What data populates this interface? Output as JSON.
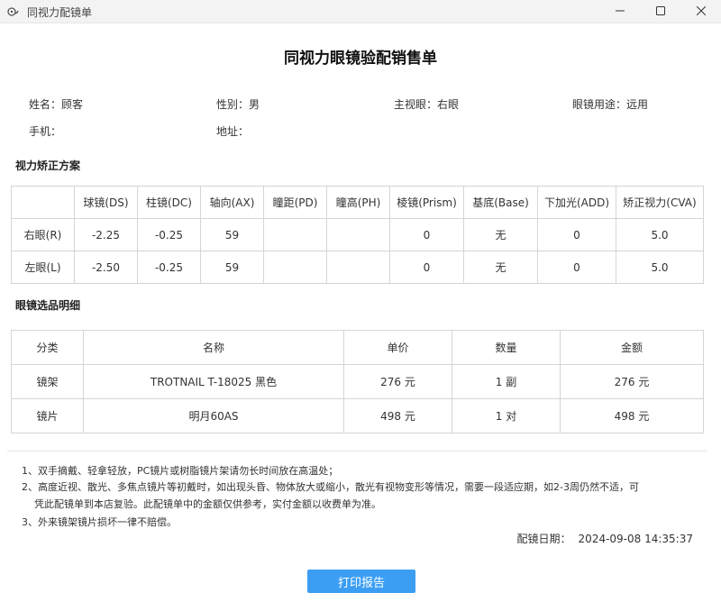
{
  "window": {
    "title": "同视力配镜单"
  },
  "document": {
    "title": "同视力眼镜验配销售单"
  },
  "customer": {
    "name_label": "姓名：",
    "name": "顾客",
    "gender_label": "性别：",
    "gender": "男",
    "dominant_eye_label": "主视眼：",
    "dominant_eye": "右眼",
    "usage_label": "眼镜用途：",
    "usage": "远用",
    "phone_label": "手机：",
    "phone": "",
    "address_label": "地址：",
    "address": ""
  },
  "vision": {
    "section_title": "视力矫正方案",
    "headers": [
      "",
      "球镜(DS)",
      "柱镜(DC)",
      "轴向(AX)",
      "瞳距(PD)",
      "瞳高(PH)",
      "棱镜(Prism)",
      "基底(Base)",
      "下加光(ADD)",
      "矫正视力(CVA)"
    ],
    "rows": [
      [
        "右眼(R)",
        "-2.25",
        "-0.25",
        "59",
        "",
        "",
        "0",
        "无",
        "0",
        "5.0"
      ],
      [
        "左眼(L)",
        "-2.50",
        "-0.25",
        "59",
        "",
        "",
        "0",
        "无",
        "0",
        "5.0"
      ]
    ]
  },
  "products": {
    "section_title": "眼镜选品明细",
    "headers": [
      "分类",
      "名称",
      "单价",
      "数量",
      "金额"
    ],
    "rows": [
      [
        "镜架",
        "TROTNAIL T-18025 黑色",
        "276 元",
        "1 副",
        "276 元"
      ],
      [
        "镜片",
        "明月60AS",
        "498 元",
        "1 对",
        "498 元"
      ]
    ]
  },
  "notes": [
    "1、双手摘戴、轻拿轻放，PC镜片或树脂镜片架请勿长时间放在高温处；",
    "2、高度近视、散光、多焦点镜片等初戴时，如出现头昏、物体放大或缩小，散光有视物变形等情况，需要一段适应期，如2-3周仍然不适，可",
    "凭此配镜单到本店复验。此配镜单中的金额仅供参考，实付金额以收费单为准。",
    "3、外来镜架镜片损坏一律不赔偿。"
  ],
  "footer": {
    "date_label": "配镜日期：",
    "date": "2024-09-08 14:35:37"
  },
  "actions": {
    "print_label": "打印报告"
  }
}
